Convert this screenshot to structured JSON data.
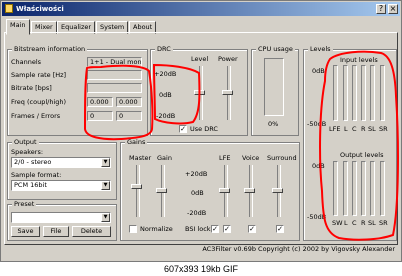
{
  "window": {
    "title": "Właściwości",
    "buttons": [
      "?",
      "×"
    ]
  },
  "tabs": [
    {
      "label": "Main",
      "active": true
    },
    {
      "label": "Mixer",
      "active": false
    },
    {
      "label": "Equalizer",
      "active": false
    },
    {
      "label": "System",
      "active": false
    },
    {
      "label": "About",
      "active": false
    }
  ],
  "bitstream": {
    "title": "Bitstream information",
    "channels_label": "Channels",
    "channels_value": "1+1 - Dual mono",
    "sample_rate_label": "Sample rate [Hz]",
    "bitrate_label": "Bitrate [bps]",
    "freq_label": "Freq (coupl/high)",
    "freq_values": [
      "0.000",
      "0.000"
    ],
    "frames_label": "Frames / Errors",
    "frames_values": [
      "0",
      "0"
    ]
  },
  "drc": {
    "title": "DRC",
    "level_label": "Level",
    "power_label": "Power",
    "scale": [
      "+20dB",
      "0dB",
      "-20dB"
    ],
    "use_drc_label": "Use DRC",
    "use_drc_checked": true
  },
  "cpu": {
    "title": "CPU usage",
    "value": "0%"
  },
  "levels": {
    "title": "Levels",
    "input_label": "Input levels",
    "output_label": "Output levels",
    "input_scale": [
      "0dB",
      "-50dB"
    ],
    "output_scale": [
      "0dB",
      "-50dB"
    ],
    "input_channels": [
      "LFE",
      "L",
      "C",
      "R",
      "SL",
      "SR"
    ],
    "output_channels": [
      "SW",
      "L",
      "C",
      "R",
      "SL",
      "SR"
    ]
  },
  "output": {
    "title": "Output",
    "speakers_label": "Speakers:",
    "speakers_value": "2/0 - stereo",
    "format_label": "Sample format:",
    "format_value": "PCM 16bit"
  },
  "preset": {
    "title": "Preset",
    "value": "",
    "save_label": "Save",
    "file_label": "File",
    "delete_label": "Delete"
  },
  "gains": {
    "title": "Gains",
    "master_label": "Master",
    "gain_label": "Gain",
    "lfe_label": "LFE",
    "voice_label": "Voice",
    "surround_label": "Surround",
    "scale": [
      "+20dB",
      "0dB",
      "-20dB"
    ],
    "normalize_label": "Normalize",
    "normalize_checked": false,
    "bsi_lock_label": "BSI lock:",
    "bsi_lock_checked": true,
    "lfe_checked": true,
    "voice_checked": true,
    "surround_checked": true
  },
  "status": {
    "copyright": "AC3Filter v0.69b Copyright (c) 2002 by Vigovsky Alexander"
  },
  "caption": "607x393 19kb GIF",
  "annotation_color": "#ff0000"
}
